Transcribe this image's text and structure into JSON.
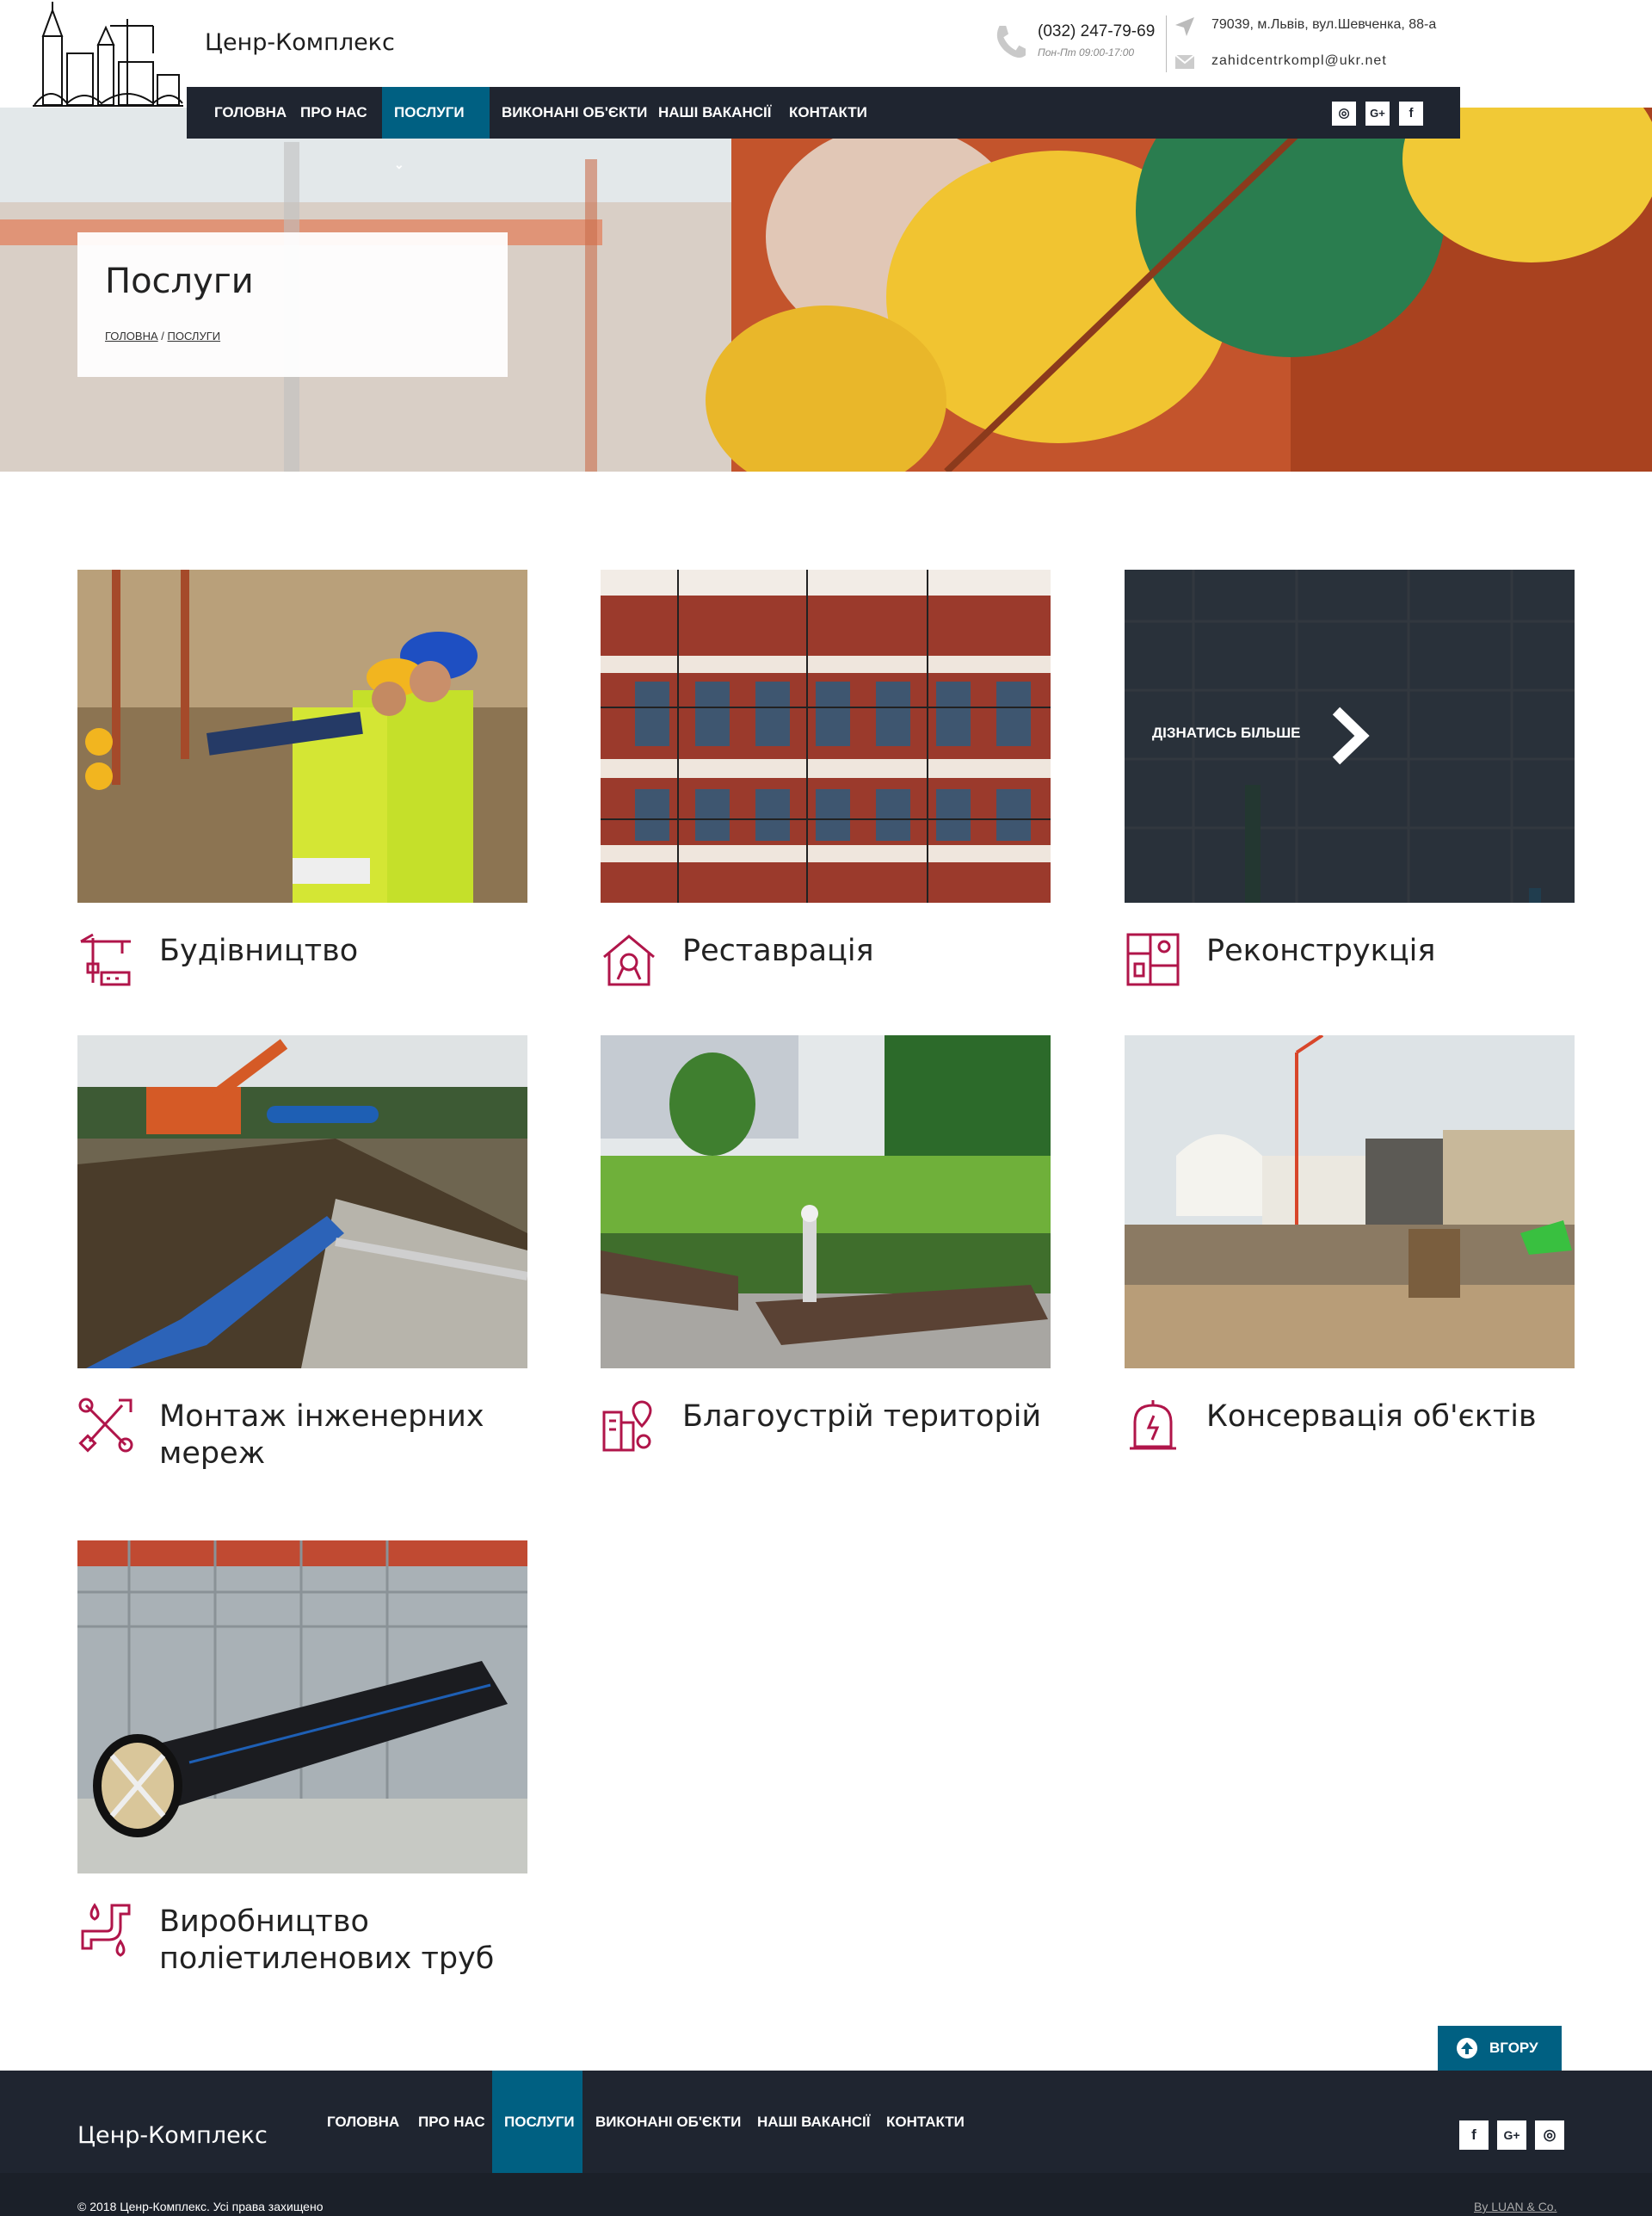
{
  "header": {
    "brand": "Ценр-Комплекс",
    "phone": "(032) 247-79-69",
    "hours": "Пон-Пт 09:00-17:00",
    "address": "79039, м.Львів, вул.Шевченка, 88-а",
    "email": "zahidcentrkompl@ukr.net"
  },
  "nav": {
    "items": [
      {
        "label": "ГОЛОВНА"
      },
      {
        "label": "ПРО НАС"
      },
      {
        "label": "ПОСЛУГИ"
      },
      {
        "label": "ВИКОНАНІ ОБ'ЄКТИ"
      },
      {
        "label": "НАШІ ВАКАНСІЇ"
      },
      {
        "label": "КОНТАКТИ"
      }
    ],
    "dropdown_glyph": "⌄",
    "social": [
      {
        "icon": "instagram-icon",
        "glyph": "◎"
      },
      {
        "icon": "google-plus-icon",
        "glyph": "G+"
      },
      {
        "icon": "facebook-icon",
        "glyph": "f"
      }
    ]
  },
  "hero": {
    "title": "Послуги",
    "breadcrumb_home": "ГОЛОВНА",
    "breadcrumb_sep": " / ",
    "breadcrumb_current": "ПОСЛУГИ"
  },
  "services": [
    {
      "title": "Будівництво",
      "icon": "crane-icon"
    },
    {
      "title": "Реставрація",
      "icon": "house-tools-icon"
    },
    {
      "title": "Реконструкція",
      "icon": "blueprint-icon",
      "hover_label": "ДІЗНАТИСЬ БІЛЬШЕ"
    },
    {
      "title": "Монтаж інженерних мереж",
      "icon": "wrench-screwdriver-icon"
    },
    {
      "title": "Благоустрій територій",
      "icon": "city-location-icon"
    },
    {
      "title": "Консервація об'єктів",
      "icon": "bell-jar-icon"
    },
    {
      "title": "Виробництво поліетиленових труб",
      "icon": "pipe-drops-icon"
    }
  ],
  "to_top": {
    "label": "ВГОРУ"
  },
  "footer": {
    "brand": "Ценр-Комплекс",
    "nav": [
      {
        "label": "ГОЛОВНА"
      },
      {
        "label": "ПРО НАС"
      },
      {
        "label": "ПОСЛУГИ"
      },
      {
        "label": "ВИКОНАНІ ОБ'ЄКТИ"
      },
      {
        "label": "НАШІ ВАКАНСІЇ"
      },
      {
        "label": "КОНТАКТИ"
      }
    ],
    "social": [
      {
        "icon": "facebook-icon",
        "glyph": "f"
      },
      {
        "icon": "google-plus-icon",
        "glyph": "G+"
      },
      {
        "icon": "instagram-icon",
        "glyph": "◎"
      }
    ],
    "copyright": "© 2018 Ценр-Комплекс. Усі права захищено",
    "credit": "By LUAN & Co."
  },
  "colors": {
    "accent": "#006082",
    "dark": "#1f2530",
    "icon": "#b0154a"
  }
}
